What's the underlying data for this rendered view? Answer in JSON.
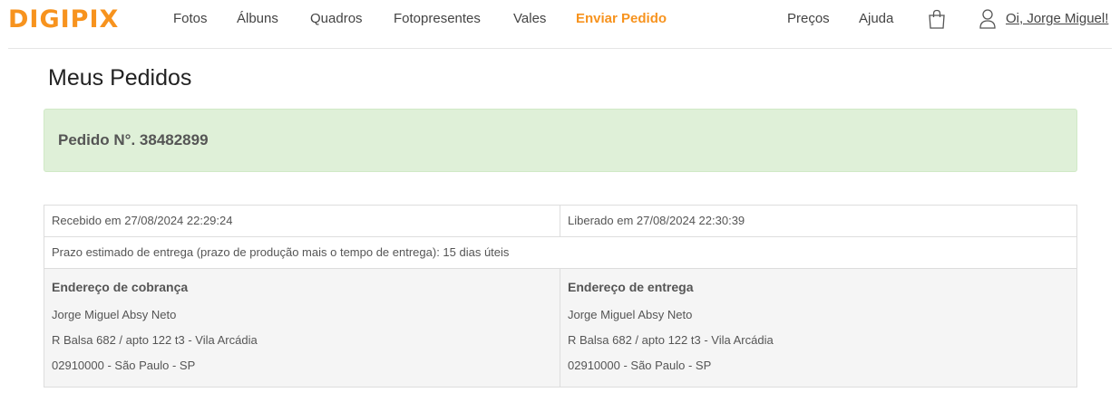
{
  "header": {
    "logo_text": "DIGIPIX",
    "nav": [
      {
        "label": "Fotos"
      },
      {
        "label": "Álbuns"
      },
      {
        "label": "Quadros"
      },
      {
        "label": "Fotopresentes"
      },
      {
        "label": "Vales"
      },
      {
        "label": "Enviar Pedido",
        "active": true
      }
    ],
    "right_nav": [
      {
        "label": "Preços"
      },
      {
        "label": "Ajuda"
      }
    ],
    "cart_icon": "shopping-bag-icon",
    "user_icon": "user-icon",
    "greeting": "Oi, Jorge Miguel!"
  },
  "colors": {
    "brand": "#f7931e",
    "alert_bg": "#dff0d8",
    "table_alt_bg": "#f5f5f5"
  },
  "page": {
    "title": "Meus Pedidos"
  },
  "order": {
    "number_label": "Pedido N°. 38482899",
    "received": "Recebido em 27/08/2024 22:29:24",
    "released": "Liberado em 27/08/2024 22:30:39",
    "delivery_estimate": "Prazo estimado de entrega (prazo de produção mais o tempo de entrega): 15 dias úteis",
    "billing": {
      "heading": "Endereço de cobrança",
      "name": "Jorge Miguel Absy Neto",
      "street": "R Balsa 682 / apto 122 t3 - Vila Arcádia",
      "city": "02910000 - São Paulo - SP"
    },
    "shipping": {
      "heading": "Endereço de entrega",
      "name": "Jorge Miguel Absy Neto",
      "street": "R Balsa 682 / apto 122 t3 - Vila Arcádia",
      "city": "02910000 - São Paulo - SP"
    }
  }
}
